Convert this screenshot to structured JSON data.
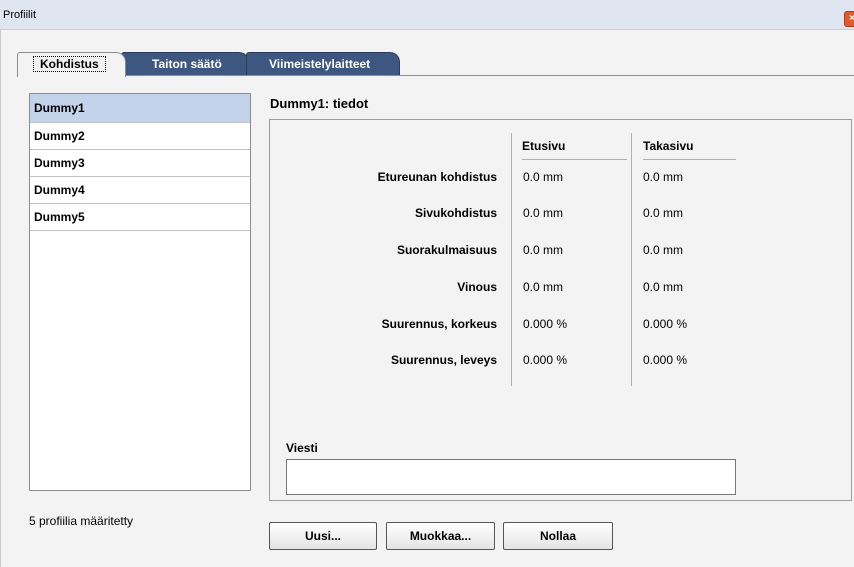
{
  "window": {
    "title": "Profiilit"
  },
  "tabs": [
    {
      "label": "Kohdistus",
      "active": true
    },
    {
      "label": "Taiton säätö",
      "active": false
    },
    {
      "label": "Viimeistelylaitteet",
      "active": false
    }
  ],
  "profiles": {
    "items": [
      {
        "label": "Dummy1",
        "selected": true
      },
      {
        "label": "Dummy2",
        "selected": false
      },
      {
        "label": "Dummy3",
        "selected": false
      },
      {
        "label": "Dummy4",
        "selected": false
      },
      {
        "label": "Dummy5",
        "selected": false
      }
    ],
    "count_label": "5 profiilia määritetty"
  },
  "details": {
    "title": "Dummy1: tiedot",
    "columns": [
      "Etusivu",
      "Takasivu"
    ],
    "rows": [
      {
        "label": "Etureunan kohdistus",
        "front": "0.0 mm",
        "back": "0.0 mm"
      },
      {
        "label": "Sivukohdistus",
        "front": "0.0 mm",
        "back": "0.0 mm"
      },
      {
        "label": "Suorakulmaisuus",
        "front": "0.0 mm",
        "back": "0.0 mm"
      },
      {
        "label": "Vinous",
        "front": "0.0 mm",
        "back": "0.0 mm"
      },
      {
        "label": "Suurennus, korkeus",
        "front": "0.000 %",
        "back": "0.000 %"
      },
      {
        "label": "Suurennus, leveys",
        "front": "0.000 %",
        "back": "0.000 %"
      }
    ],
    "message_label": "Viesti",
    "message_value": ""
  },
  "buttons": {
    "new": "Uusi...",
    "edit": "Muokkaa...",
    "reset": "Nollaa"
  },
  "colors": {
    "inactive_tab": "#3e5780",
    "selection": "#c3d3ea",
    "close_button": "#e05b30"
  }
}
